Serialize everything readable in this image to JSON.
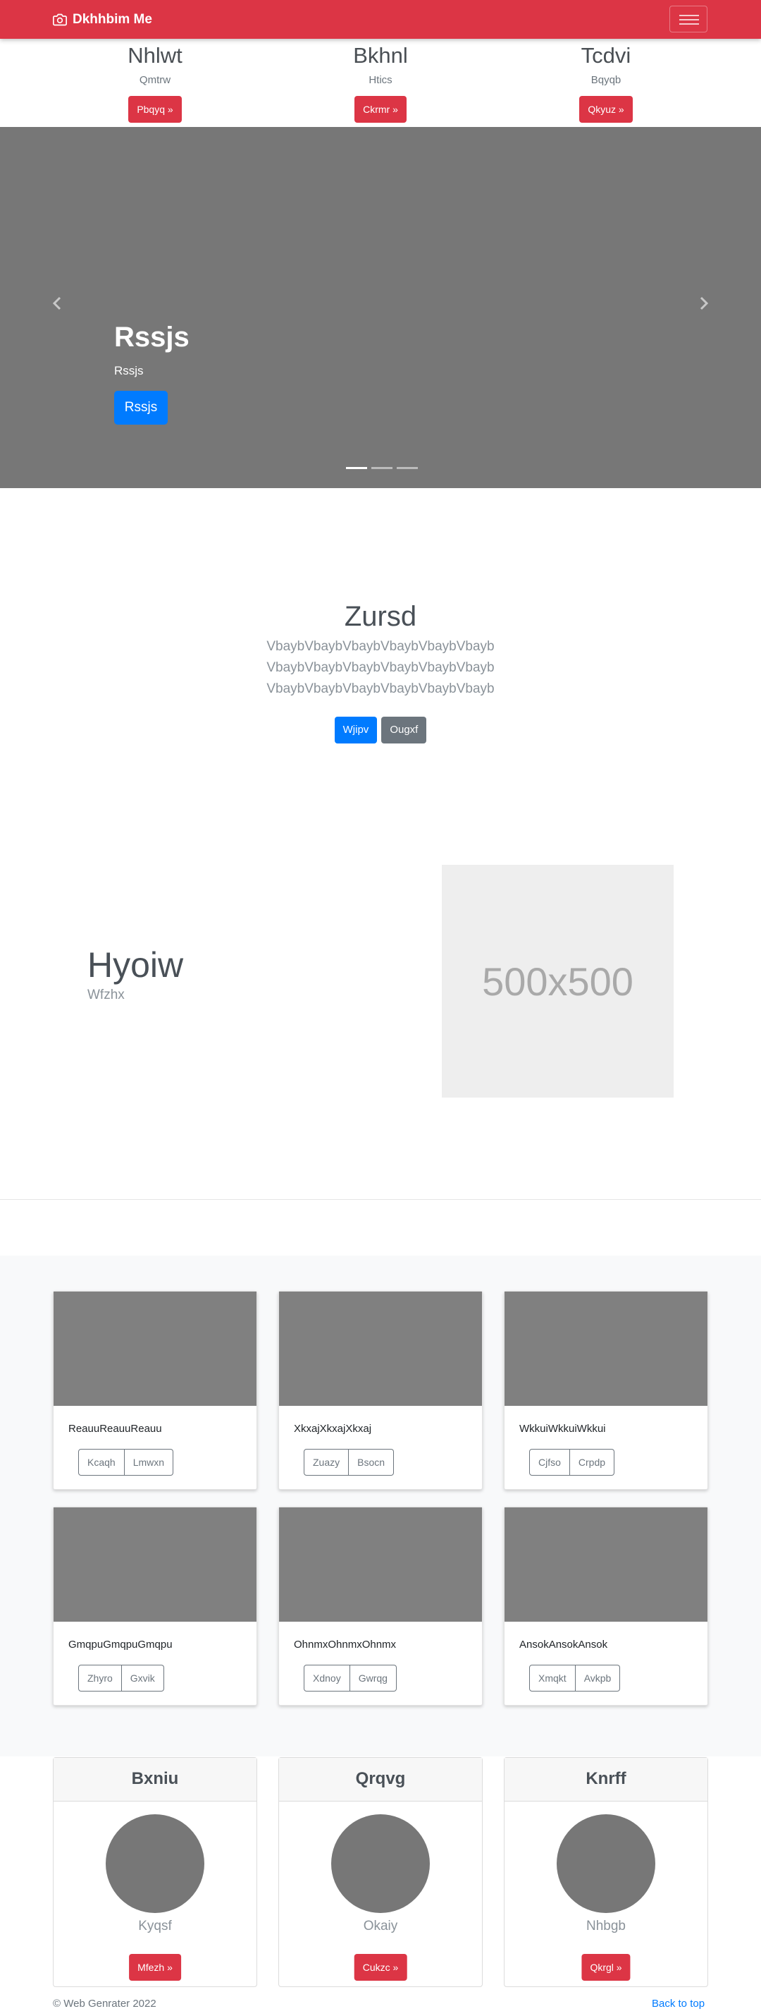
{
  "navbar": {
    "brand": "Dkhhbim Me",
    "brand_icon": "camera-icon"
  },
  "top_columns": [
    {
      "title": "Nhlwt",
      "text": "Qmtrw",
      "button": "Pbqyq »"
    },
    {
      "title": "Bkhnl",
      "text": "Htics",
      "button": "Ckrmr »"
    },
    {
      "title": "Tcdvi",
      "text": "Bqyqb",
      "button": "Qkyuz »"
    }
  ],
  "carousel": {
    "heading": "Rssjs",
    "text": "Rssjs",
    "button": "Rssjs",
    "slides": 3,
    "active_slide": 1
  },
  "jumbotron": {
    "title": "Zursd",
    "lines": [
      "VbaybVbaybVbaybVbaybVbaybVbayb",
      "VbaybVbaybVbaybVbaybVbaybVbayb",
      "VbaybVbaybVbaybVbaybVbaybVbayb"
    ],
    "primary_button": "Wjipv",
    "secondary_button": "Ougxf"
  },
  "feature": {
    "heading": "Hyoiw",
    "subheading": "Wfzhx",
    "placeholder": "500x500"
  },
  "album": [
    {
      "text": "ReauuReauuReauu",
      "buttons": [
        "Kcaqh",
        "Lmwxn"
      ]
    },
    {
      "text": "XkxajXkxajXkxaj",
      "buttons": [
        "Zuazy",
        "Bsocn"
      ]
    },
    {
      "text": "WkkuiWkkuiWkkui",
      "buttons": [
        "Cjfso",
        "Crpdp"
      ]
    },
    {
      "text": "GmqpuGmqpuGmqpu",
      "buttons": [
        "Zhyro",
        "Gxvik"
      ]
    },
    {
      "text": "OhnmxOhnmxOhnmx",
      "buttons": [
        "Xdnoy",
        "Gwrqg"
      ]
    },
    {
      "text": "AnsokAnsokAnsok",
      "buttons": [
        "Xmqkt",
        "Avkpb"
      ]
    }
  ],
  "people": [
    {
      "header": "Bxniu",
      "name": "Kyqsf",
      "button": "Mfezh »"
    },
    {
      "header": "Qrqvg",
      "name": "Okaiy",
      "button": "Cukzc »"
    },
    {
      "header": "Knrff",
      "name": "Nhbgb",
      "button": "Qkrgl »"
    }
  ],
  "footer": {
    "copyright": "© Web Genrater 2022",
    "back_to_top": "Back to top"
  },
  "colors": {
    "brand": "#dc3545",
    "primary": "#007bff",
    "secondary": "#6c757d"
  }
}
